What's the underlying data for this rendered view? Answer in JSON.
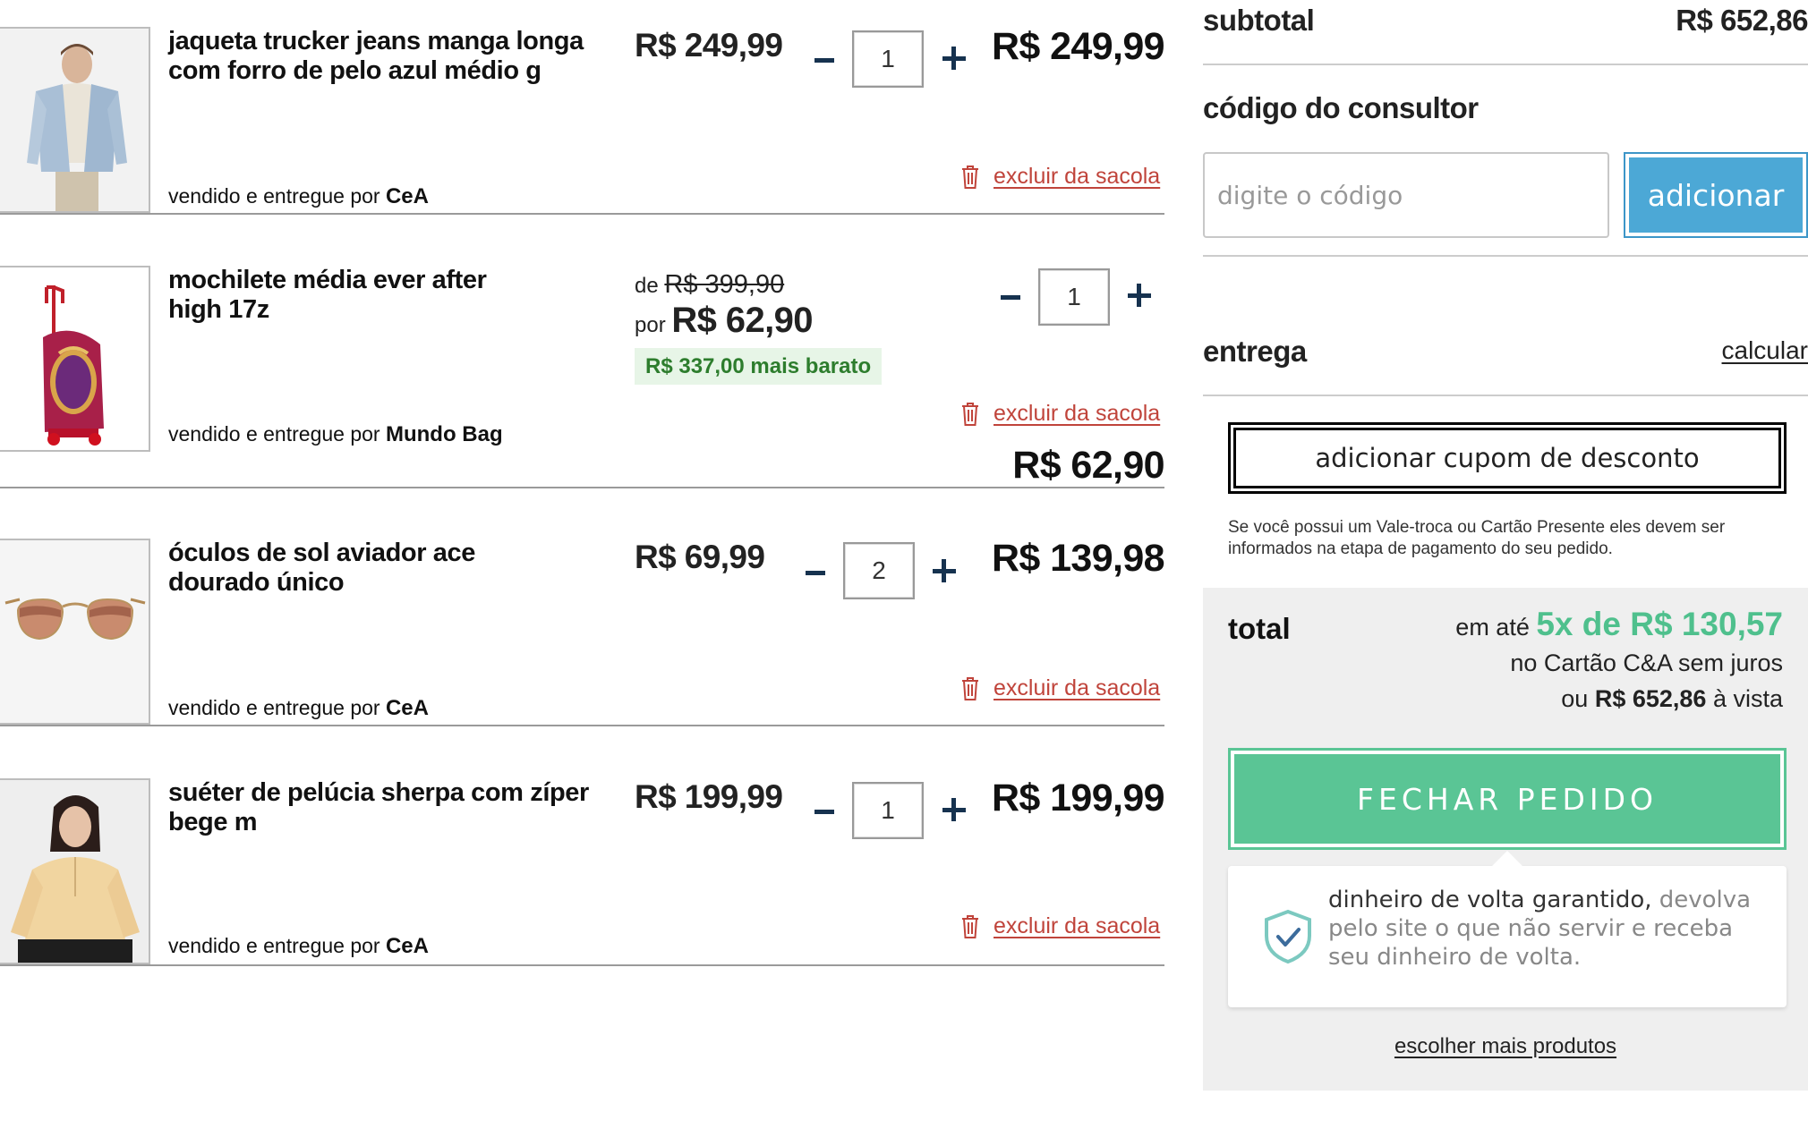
{
  "cart": {
    "remove_label": "excluir da sacola",
    "seller_prefix": "vendido e entregue por",
    "items": [
      {
        "name": "jaqueta trucker jeans manga longa com forro de pelo azul médio g",
        "seller": "CeA",
        "unit_price": "R$ 249,99",
        "quantity": "1",
        "line_total": "R$ 249,99"
      },
      {
        "name": "mochilete média ever after high 17z",
        "seller": "Mundo Bag",
        "old_prefix": "de",
        "old_price": "R$ 399,90",
        "sale_prefix": "por",
        "sale_price": "R$ 62,90",
        "discount": "R$ 337,00 mais barato",
        "quantity": "1",
        "line_total": "R$ 62,90"
      },
      {
        "name": "óculos de sol aviador ace dourado único",
        "seller": "CeA",
        "unit_price": "R$ 69,99",
        "quantity": "2",
        "line_total": "R$ 139,98"
      },
      {
        "name": "suéter de pelúcia sherpa com zíper bege m",
        "seller": "CeA",
        "unit_price": "R$ 199,99",
        "quantity": "1",
        "line_total": "R$ 199,99"
      }
    ]
  },
  "summary": {
    "subtotal_label": "subtotal",
    "subtotal_value": "R$ 652,86",
    "consultor_title": "código do consultor",
    "consultor_placeholder": "digite o código",
    "consultor_button": "adicionar",
    "entrega_label": "entrega",
    "entrega_link": "calcular",
    "coupon_button": "adicionar cupom de desconto",
    "vale_note": "Se você possui um Vale-troca ou Cartão Presente eles devem ser informados na etapa de pagamento do seu pedido.",
    "total_label": "total",
    "installment_prefix": "em até",
    "installment_value": "5x de R$ 130,57",
    "installment_suffix": "no Cartão C&A sem juros",
    "cash_prefix": "ou",
    "cash_value": "R$ 652,86",
    "cash_suffix": "à vista",
    "checkout_button": "FECHAR PEDIDO",
    "guarantee_bold": "dinheiro de volta garantido,",
    "guarantee_rest": "devolva pelo site o que não servir e receba seu dinheiro de volta.",
    "more_products": "escolher mais produtos"
  },
  "colors": {
    "accent_blue": "#4ca8d6",
    "checkout_green": "#5ac595",
    "installment_green": "#4fc08d",
    "remove_red": "#c0443b",
    "qty_navy": "#16324f"
  },
  "icons": [
    "trash-icon",
    "minus-icon",
    "plus-icon",
    "shield-check-icon"
  ]
}
